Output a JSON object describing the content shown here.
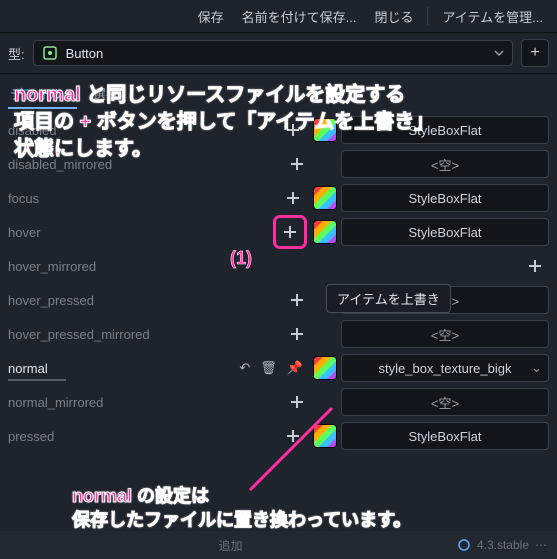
{
  "topbar": {
    "save": "保存",
    "save_as": "名前を付けて保存...",
    "close": "閉じる",
    "manage": "アイテムを管理..."
  },
  "type_row": {
    "label": "型:",
    "value": "Button"
  },
  "tabs": [
    "デフォルト",
    "選択"
  ],
  "rows": [
    {
      "name": "disabled",
      "add": true,
      "swatch": true,
      "value": "StyleBoxFlat",
      "empty": false
    },
    {
      "name": "disabled_mirrored",
      "add": true,
      "swatch": false,
      "value": "<空>",
      "empty": true
    },
    {
      "name": "focus",
      "add": true,
      "swatch": true,
      "value": "StyleBoxFlat",
      "empty": false
    },
    {
      "name": "hover",
      "add": true,
      "hl": true,
      "swatch": true,
      "value": "StyleBoxFlat",
      "empty": false
    },
    {
      "name": "hover_mirrored",
      "add": true,
      "swatch": false,
      "value": "<空>",
      "empty": true,
      "shift": true
    },
    {
      "name": "hover_pressed",
      "add": true,
      "swatch": false,
      "value": "<空>",
      "empty": true
    },
    {
      "name": "hover_pressed_mirrored",
      "add": true,
      "swatch": false,
      "value": "<空>",
      "empty": true
    },
    {
      "name": "normal",
      "toolbar": true,
      "swatch": true,
      "value": "style_box_texture_bigk",
      "empty": false,
      "chev": true,
      "underline": true,
      "active": true
    },
    {
      "name": "normal_mirrored",
      "add": true,
      "swatch": false,
      "value": "<空>",
      "empty": true
    },
    {
      "name": "pressed",
      "add": true,
      "swatch": true,
      "value": "StyleBoxFlat",
      "empty": false
    }
  ],
  "tooltip": "アイテムを上書き",
  "marker": "(1)",
  "anno1_l1": "normal と同じリソースファイルを設定する",
  "anno1_l2": "項目の + ボタンを押して「アイテムを上書き」",
  "anno1_l3": "状態にします。",
  "anno2_l1": "normal の設定は",
  "anno2_l2": "保存したファイルに置き換わっています。",
  "footer": {
    "add": "追加",
    "version": "4.3.stable"
  }
}
